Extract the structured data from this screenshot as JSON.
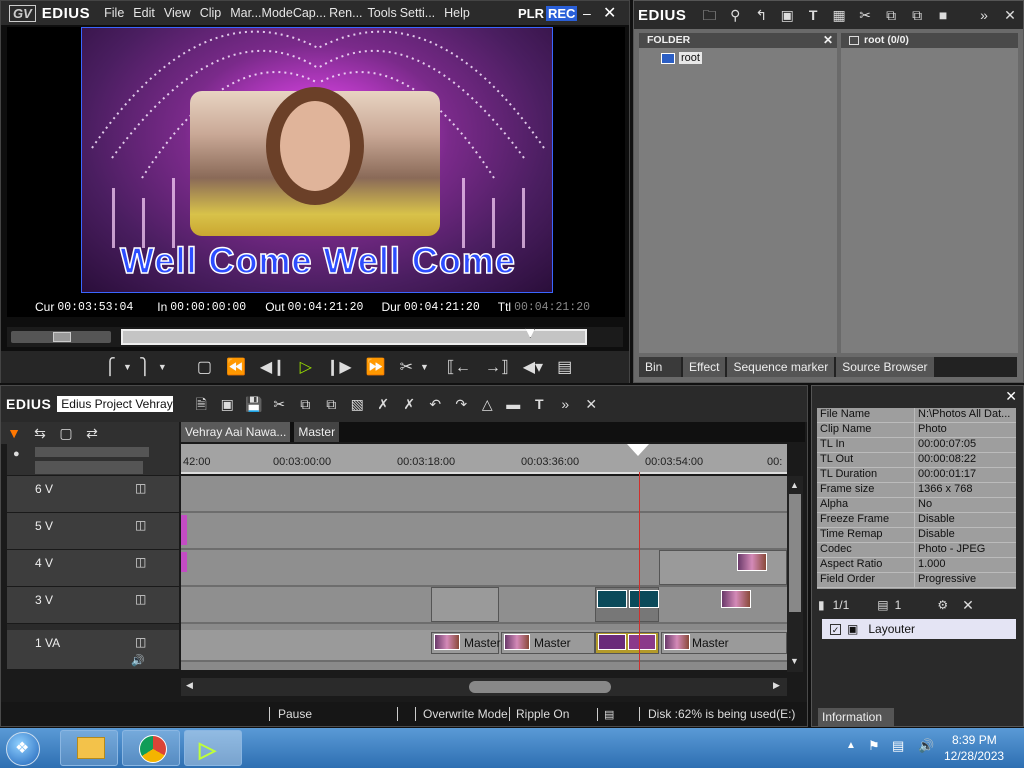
{
  "player": {
    "app_name": "EDIUS",
    "menu": [
      "File",
      "Edit",
      "View",
      "Clip",
      "Mar...",
      "Mode",
      "Cap...",
      "Ren...",
      "Tools",
      "Setti...",
      "Help"
    ],
    "plr": "PLR",
    "rec": "REC",
    "title_text": "Well Come Well Come",
    "timecodes": {
      "cur_label": "Cur",
      "cur": "00:03:53:04",
      "in_label": "In",
      "in": "00:00:00:00",
      "out_label": "Out",
      "out": "00:04:21:20",
      "dur_label": "Dur",
      "dur": "00:04:21:20",
      "ttl_label": "Ttl",
      "ttl": "00:04:21:20"
    },
    "playhead_fraction": 0.89
  },
  "bin": {
    "app_name": "EDIUS",
    "folder_header": "FOLDER",
    "folder_item": "root",
    "root_header": "root (0/0)",
    "tabs": [
      "Bin",
      "Effect",
      "Sequence marker",
      "Source Browser"
    ]
  },
  "timeline": {
    "app_name": "EDIUS",
    "project": "Edius Project Vehray ...",
    "tabs": [
      "Vehray Aai Nawa...",
      "Master"
    ],
    "ruler_labels": [
      "42:00",
      "00:03:00:00",
      "00:03:18:00",
      "00:03:36:00",
      "00:03:54:00",
      "00:"
    ],
    "tracks": [
      "6 V",
      "5 V",
      "4 V",
      "3 V",
      "1 VA"
    ],
    "clip_labels": [
      "Master",
      "Master",
      "Master"
    ],
    "status": {
      "mode": "Pause",
      "overwrite": "Overwrite Mode",
      "ripple": "Ripple On",
      "disk": "Disk :62% is being used(E:)"
    }
  },
  "info": {
    "properties": [
      [
        "File Name",
        "N:\\Photos All Dat..."
      ],
      [
        "Clip Name",
        "Photo"
      ],
      [
        "TL In",
        "00:00:07:05"
      ],
      [
        "TL Out",
        "00:00:08:22"
      ],
      [
        "TL Duration",
        "00:00:01:17"
      ],
      [
        "Frame size",
        "1366 x 768"
      ],
      [
        "Alpha",
        "No"
      ],
      [
        "Freeze Frame",
        "Disable"
      ],
      [
        "Time Remap",
        "Disable"
      ],
      [
        "Codec",
        "Photo - JPEG"
      ],
      [
        "Aspect Ratio",
        "1.000"
      ],
      [
        "Field Order",
        "Progressive"
      ]
    ],
    "count": "1/1",
    "layer_count": "1",
    "layouter": "Layouter",
    "tab": "Information"
  },
  "taskbar": {
    "time": "8:39 PM",
    "date": "12/28/2023"
  }
}
